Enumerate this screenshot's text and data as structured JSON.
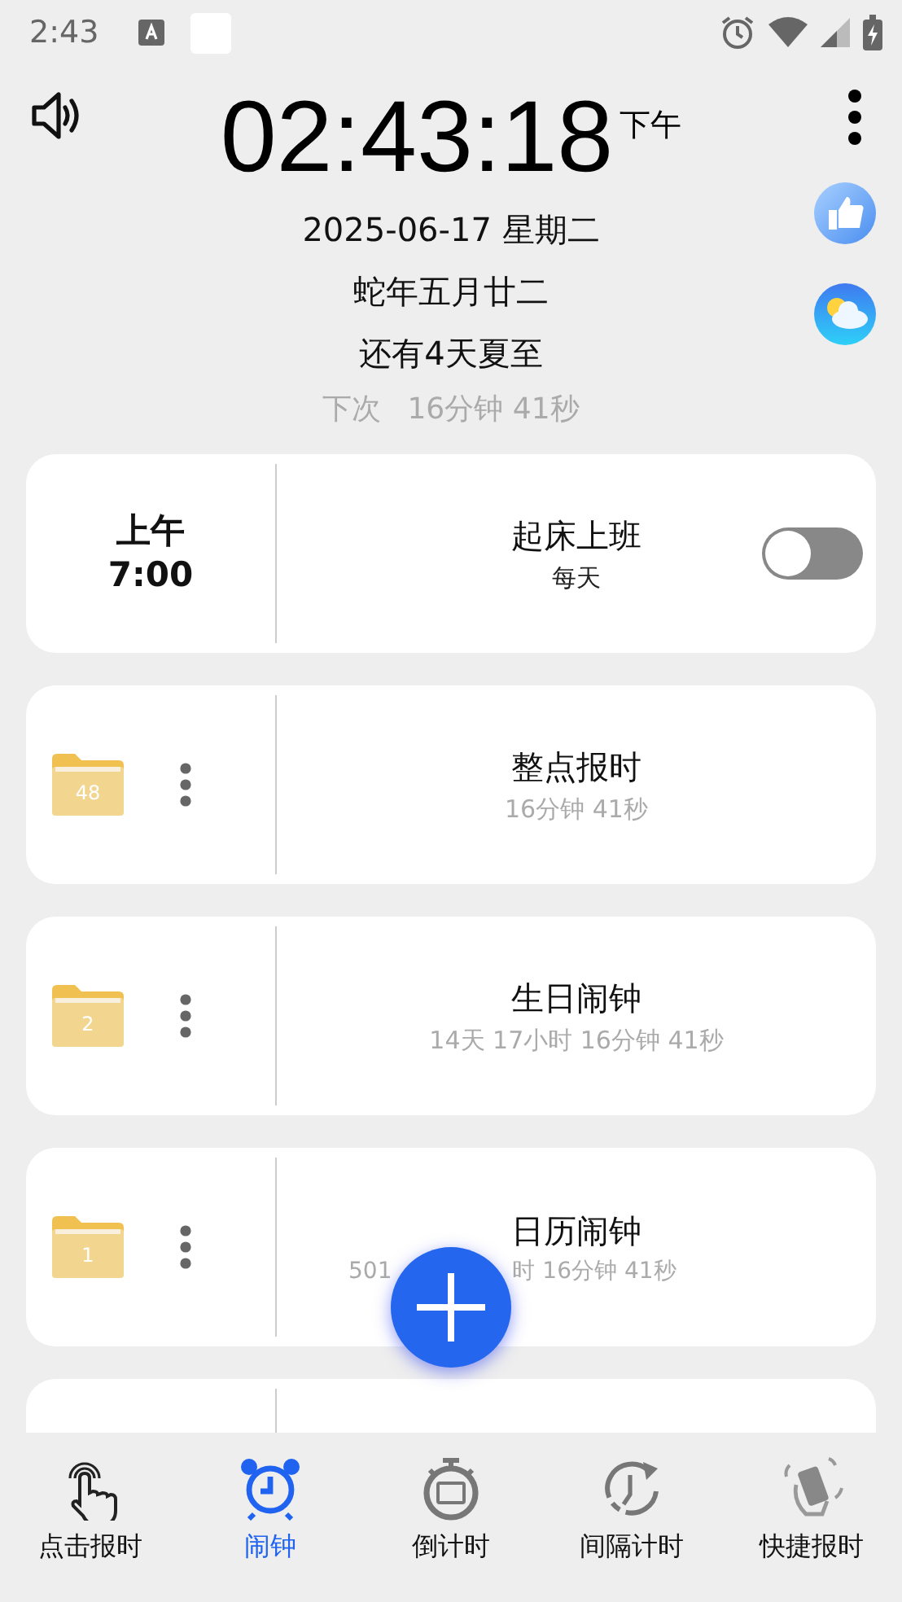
{
  "status_bar": {
    "time": "2:43"
  },
  "header": {
    "time": "02:43:18",
    "meridiem": "下午",
    "date": "2025-06-17 星期二",
    "lunar": "蛇年五月廿二",
    "solar_term": "还有4天夏至",
    "next_label": "下次",
    "next_in": "16分钟 41秒"
  },
  "cards": [
    {
      "kind": "alarm",
      "meridiem": "上午",
      "time": "7:00",
      "title": "起床上班",
      "repeat": "每天",
      "on": false
    },
    {
      "kind": "folder",
      "count": "48",
      "title": "整点报时",
      "countdown": "16分钟 41秒"
    },
    {
      "kind": "folder",
      "count": "2",
      "title": "生日闹钟",
      "countdown": "14天 17小时 16分钟 41秒"
    },
    {
      "kind": "folder",
      "count": "1",
      "title": "日历闹钟",
      "countdown_parts": [
        "501",
        "时 16分钟 41秒"
      ]
    },
    {
      "kind": "empty"
    }
  ],
  "nav": [
    {
      "kind": "tap",
      "label": "点击报时",
      "selected": false
    },
    {
      "kind": "alarm",
      "label": "闹钟",
      "selected": true
    },
    {
      "kind": "stopwatch",
      "label": "倒计时",
      "selected": false
    },
    {
      "kind": "interval",
      "label": "间隔计时",
      "selected": false
    },
    {
      "kind": "shake",
      "label": "快捷报时",
      "selected": false
    }
  ]
}
